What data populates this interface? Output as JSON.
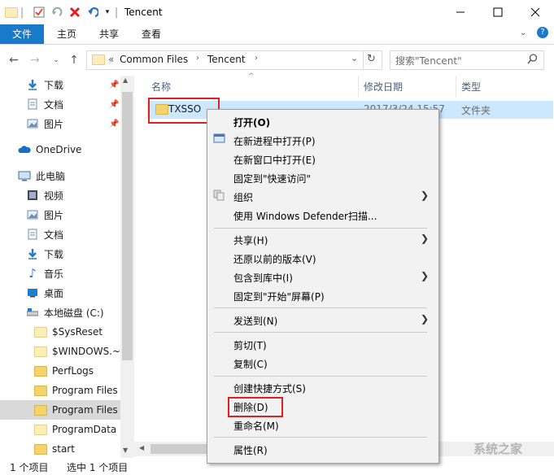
{
  "window": {
    "title": "Tencent",
    "minimize_icon": "minimize-icon",
    "maximize_icon": "maximize-icon",
    "close_icon": "close-icon"
  },
  "ribbon": {
    "tabs": [
      {
        "label": "文件"
      },
      {
        "label": "主页"
      },
      {
        "label": "共享"
      },
      {
        "label": "查看"
      }
    ]
  },
  "address": {
    "prefix": "«",
    "segments": [
      "Common Files",
      "Tencent"
    ],
    "search_placeholder": "搜索\"Tencent\""
  },
  "sidebar": {
    "quick_access": [
      {
        "label": "下载",
        "icon": "download-icon"
      },
      {
        "label": "文档",
        "icon": "document-icon"
      },
      {
        "label": "图片",
        "icon": "picture-icon"
      }
    ],
    "onedrive": "OneDrive",
    "this_pc": "此电脑",
    "pc_items": [
      {
        "label": "视频",
        "icon": "video-icon"
      },
      {
        "label": "图片",
        "icon": "picture-icon"
      },
      {
        "label": "文档",
        "icon": "document-icon"
      },
      {
        "label": "下载",
        "icon": "download-icon"
      },
      {
        "label": "音乐",
        "icon": "music-icon"
      },
      {
        "label": "桌面",
        "icon": "desktop-icon"
      }
    ],
    "drive": "本地磁盘 (C:)",
    "folders": [
      {
        "label": "$SysReset"
      },
      {
        "label": "$WINDOWS.~B"
      },
      {
        "label": "PerfLogs"
      },
      {
        "label": "Program Files"
      },
      {
        "label": "Program Files ("
      },
      {
        "label": "ProgramData"
      },
      {
        "label": "start"
      }
    ]
  },
  "columns": {
    "name": "名称",
    "date": "修改日期",
    "type": "类型"
  },
  "files": [
    {
      "name": "TXSSO",
      "date": "2017/3/24 15:57",
      "type": "文件夹"
    }
  ],
  "context_menu": {
    "groups": [
      [
        {
          "label": "打开(O)",
          "bold": true
        },
        {
          "label": "在新进程中打开(P)"
        },
        {
          "label": "在新窗口中打开(E)"
        },
        {
          "label": "固定到\"快速访问\""
        },
        {
          "label": "组织",
          "submenu": true
        },
        {
          "label": "使用 Windows Defender扫描..."
        }
      ],
      [
        {
          "label": "共享(H)",
          "submenu": true
        },
        {
          "label": "还原以前的版本(V)"
        },
        {
          "label": "包含到库中(I)",
          "submenu": true
        },
        {
          "label": "固定到\"开始\"屏幕(P)"
        }
      ],
      [
        {
          "label": "发送到(N)",
          "submenu": true
        }
      ],
      [
        {
          "label": "剪切(T)"
        },
        {
          "label": "复制(C)"
        }
      ],
      [
        {
          "label": "创建快捷方式(S)"
        },
        {
          "label": "删除(D)"
        },
        {
          "label": "重命名(M)"
        }
      ],
      [
        {
          "label": "属性(R)"
        }
      ]
    ]
  },
  "status": {
    "count": "1 个项目",
    "selected": "选中 1 个项目"
  },
  "watermark": "系统之家",
  "colors": {
    "accent": "#1979ca",
    "selection": "#cce8ff",
    "highlight_box": "#e02020"
  }
}
